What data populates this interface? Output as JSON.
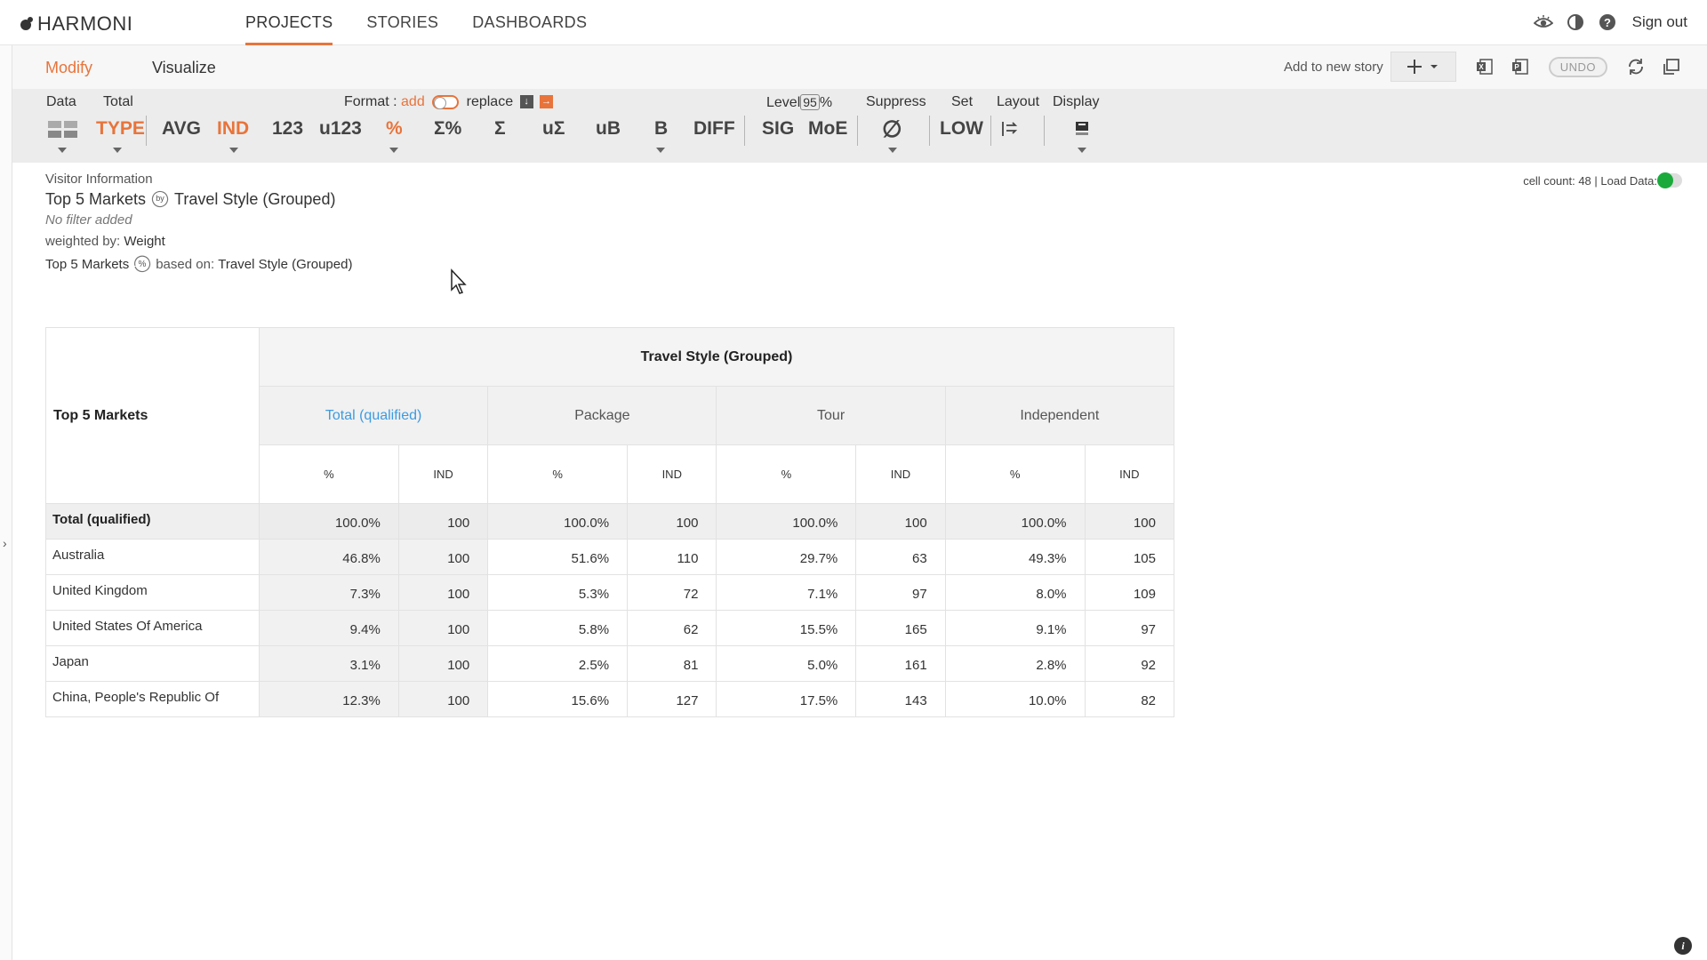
{
  "app": {
    "brand": "HARMONI"
  },
  "nav": {
    "tabs": [
      {
        "label": "PROJECTS"
      },
      {
        "label": "STORIES"
      },
      {
        "label": "DASHBOARDS"
      }
    ],
    "signout": "Sign out"
  },
  "modebar": {
    "modify": "Modify",
    "visualize": "Visualize",
    "add_to_story": "Add to new story",
    "undo": "UNDO"
  },
  "toolbar": {
    "data_label": "Data",
    "total_label": "Total",
    "format_label": "Format :",
    "format_add": "add",
    "format_replace": "replace",
    "level_label": "Level",
    "level_value": "95",
    "level_unit": "%",
    "suppress_label": "Suppress",
    "set_label": "Set",
    "layout_label": "Layout",
    "display_label": "Display",
    "buttons": {
      "type": "TYPE",
      "avg": "AVG",
      "ind": "IND",
      "n123": "123",
      "u123": "u123",
      "pct": "%",
      "sumpct": "Σ%",
      "sum": "Σ",
      "usum": "uΣ",
      "ub": "uB",
      "b": "B",
      "diff": "DIFF",
      "sig": "SIG",
      "moe": "MoE",
      "suppress_sym": "∅",
      "low": "LOW"
    }
  },
  "info": {
    "source": "Visitor Information",
    "title_left": "Top 5 Markets",
    "title_right": "Travel Style (Grouped)",
    "by_glyph": "by",
    "no_filter": "No filter added",
    "weighted_prefix": "weighted by:",
    "weighted_value": "Weight",
    "based_left": "Top 5 Markets",
    "based_prefix": "based on:",
    "based_value": "Travel Style (Grouped)",
    "cell_count": "cell count: 48 | Load Data:"
  },
  "table": {
    "corner": "Top 5 Markets",
    "group_header": "Travel Style (Grouped)",
    "columns": [
      "Total (qualified)",
      "Package",
      "Tour",
      "Independent"
    ],
    "measures": [
      "%",
      "IND"
    ],
    "rows": [
      {
        "label": "Total (qualified)",
        "values": [
          "100.0%",
          "100",
          "100.0%",
          "100",
          "100.0%",
          "100",
          "100.0%",
          "100"
        ]
      },
      {
        "label": "Australia",
        "values": [
          "46.8%",
          "100",
          "51.6%",
          "110",
          "29.7%",
          "63",
          "49.3%",
          "105"
        ]
      },
      {
        "label": "United Kingdom",
        "values": [
          "7.3%",
          "100",
          "5.3%",
          "72",
          "7.1%",
          "97",
          "8.0%",
          "109"
        ]
      },
      {
        "label": "United States Of America",
        "values": [
          "9.4%",
          "100",
          "5.8%",
          "62",
          "15.5%",
          "165",
          "9.1%",
          "97"
        ]
      },
      {
        "label": "Japan",
        "values": [
          "3.1%",
          "100",
          "2.5%",
          "81",
          "5.0%",
          "161",
          "2.8%",
          "92"
        ]
      },
      {
        "label": "China, People's Republic Of",
        "values": [
          "12.3%",
          "100",
          "15.6%",
          "127",
          "17.5%",
          "143",
          "10.0%",
          "82"
        ]
      }
    ]
  },
  "colors": {
    "accent": "#e8743b",
    "link": "#3d9be0",
    "load_on": "#1aaa3c"
  }
}
